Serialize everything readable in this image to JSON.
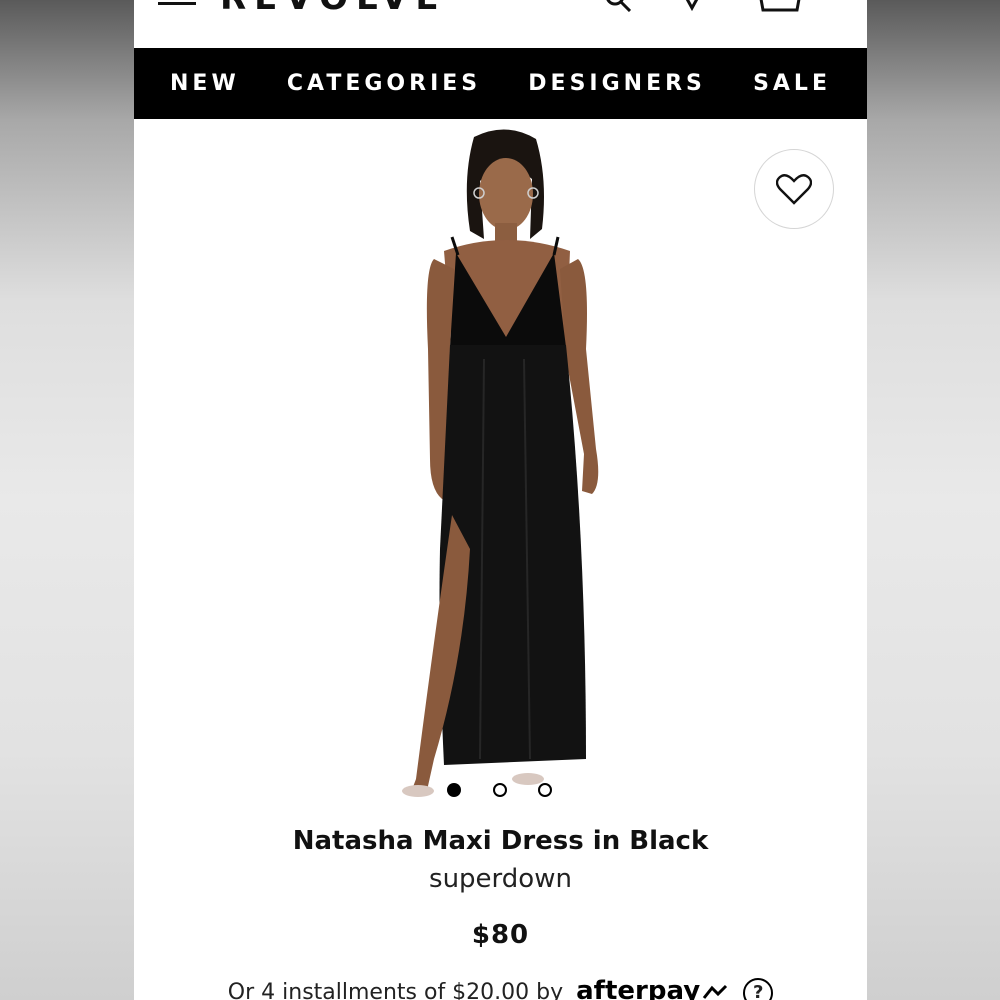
{
  "header": {
    "logo_text": "REVOLVE",
    "icons": [
      "menu-icon",
      "search-icon",
      "location-icon",
      "bag-icon"
    ]
  },
  "nav": {
    "items": [
      {
        "label": "NEW"
      },
      {
        "label": "CATEGORIES"
      },
      {
        "label": "DESIGNERS"
      },
      {
        "label": "SALE"
      }
    ]
  },
  "product": {
    "name": "Natasha Maxi Dress in Black",
    "brand": "superdown",
    "price": "$80",
    "installments_text": "Or 4 installments of $20.00 by",
    "afterpay_logo": "afterpay",
    "help_symbol": "?",
    "carousel": {
      "total": 3,
      "active_index": 0
    },
    "wishlist_icon": "heart-outline-icon"
  },
  "colors": {
    "nav_bg": "#000000",
    "nav_text": "#ffffff",
    "page_bg": "#ffffff"
  }
}
